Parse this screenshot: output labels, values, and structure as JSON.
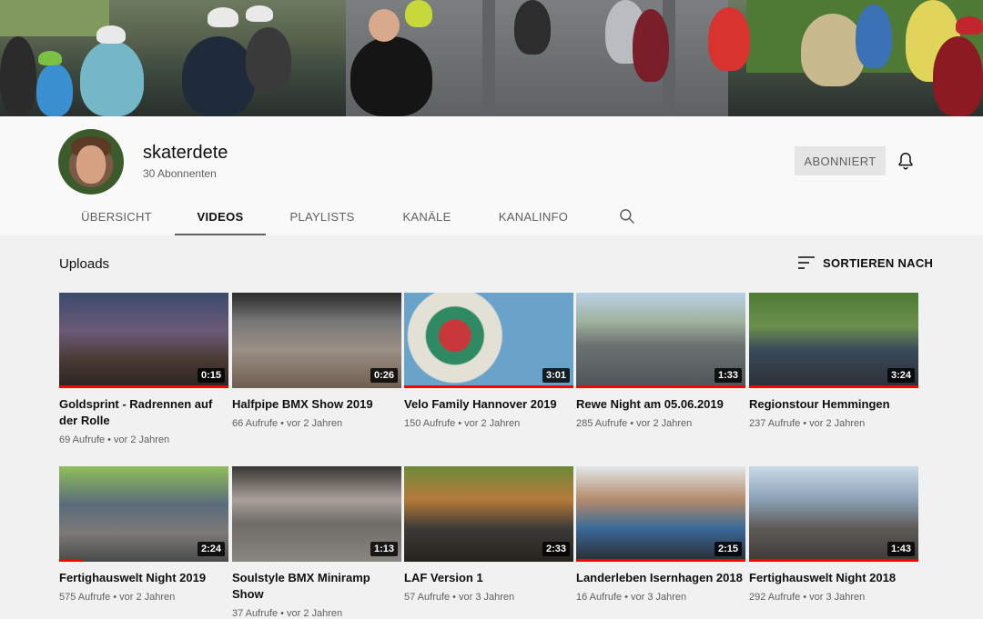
{
  "channel": {
    "name": "skaterdete",
    "subscribers": "30 Abonnenten",
    "subscribe_label": "ABONNIERT"
  },
  "tabs": [
    {
      "label": "ÜBERSICHT",
      "active": false
    },
    {
      "label": "VIDEOS",
      "active": true
    },
    {
      "label": "PLAYLISTS",
      "active": false
    },
    {
      "label": "KANÄLE",
      "active": false
    },
    {
      "label": "KANALINFO",
      "active": false
    }
  ],
  "section": {
    "title": "Uploads",
    "sort_label": "SORTIEREN NACH"
  },
  "videos": [
    {
      "title": "Goldsprint - Radrennen auf der Rolle",
      "duration": "0:15",
      "views": "69 Aufrufe",
      "age": "vor 2 Jahren",
      "progress": 1.0
    },
    {
      "title": "Halfpipe BMX Show 2019",
      "duration": "0:26",
      "views": "66 Aufrufe",
      "age": "vor 2 Jahren",
      "progress": 0
    },
    {
      "title": "Velo Family Hannover 2019",
      "duration": "3:01",
      "views": "150 Aufrufe",
      "age": "vor 2 Jahren",
      "progress": 1.0
    },
    {
      "title": "Rewe Night am 05.06.2019",
      "duration": "1:33",
      "views": "285 Aufrufe",
      "age": "vor 2 Jahren",
      "progress": 1.0
    },
    {
      "title": "Regionstour Hemmingen",
      "duration": "3:24",
      "views": "237 Aufrufe",
      "age": "vor 2 Jahren",
      "progress": 1.0
    },
    {
      "title": "Fertighauswelt Night 2019",
      "duration": "2:24",
      "views": "575 Aufrufe",
      "age": "vor 2 Jahren",
      "progress": 0.14
    },
    {
      "title": "Soulstyle BMX Miniramp Show",
      "duration": "1:13",
      "views": "37 Aufrufe",
      "age": "vor 2 Jahren",
      "progress": 0
    },
    {
      "title": "LAF Version 1",
      "duration": "2:33",
      "views": "57 Aufrufe",
      "age": "vor 3 Jahren",
      "progress": 0
    },
    {
      "title": "Landerleben Isernhagen 2018",
      "duration": "2:15",
      "views": "16 Aufrufe",
      "age": "vor 3 Jahren",
      "progress": 1.0
    },
    {
      "title": "Fertighauswelt Night 2018",
      "duration": "1:43",
      "views": "292 Aufrufe",
      "age": "vor 3 Jahren",
      "progress": 1.0
    }
  ],
  "icons": {
    "bell": "bell-icon",
    "search": "search-icon",
    "sort": "sort-icon"
  },
  "colors": {
    "progress": "#ff0000",
    "background": "#f1f1f1",
    "header": "#f9f9f9"
  }
}
